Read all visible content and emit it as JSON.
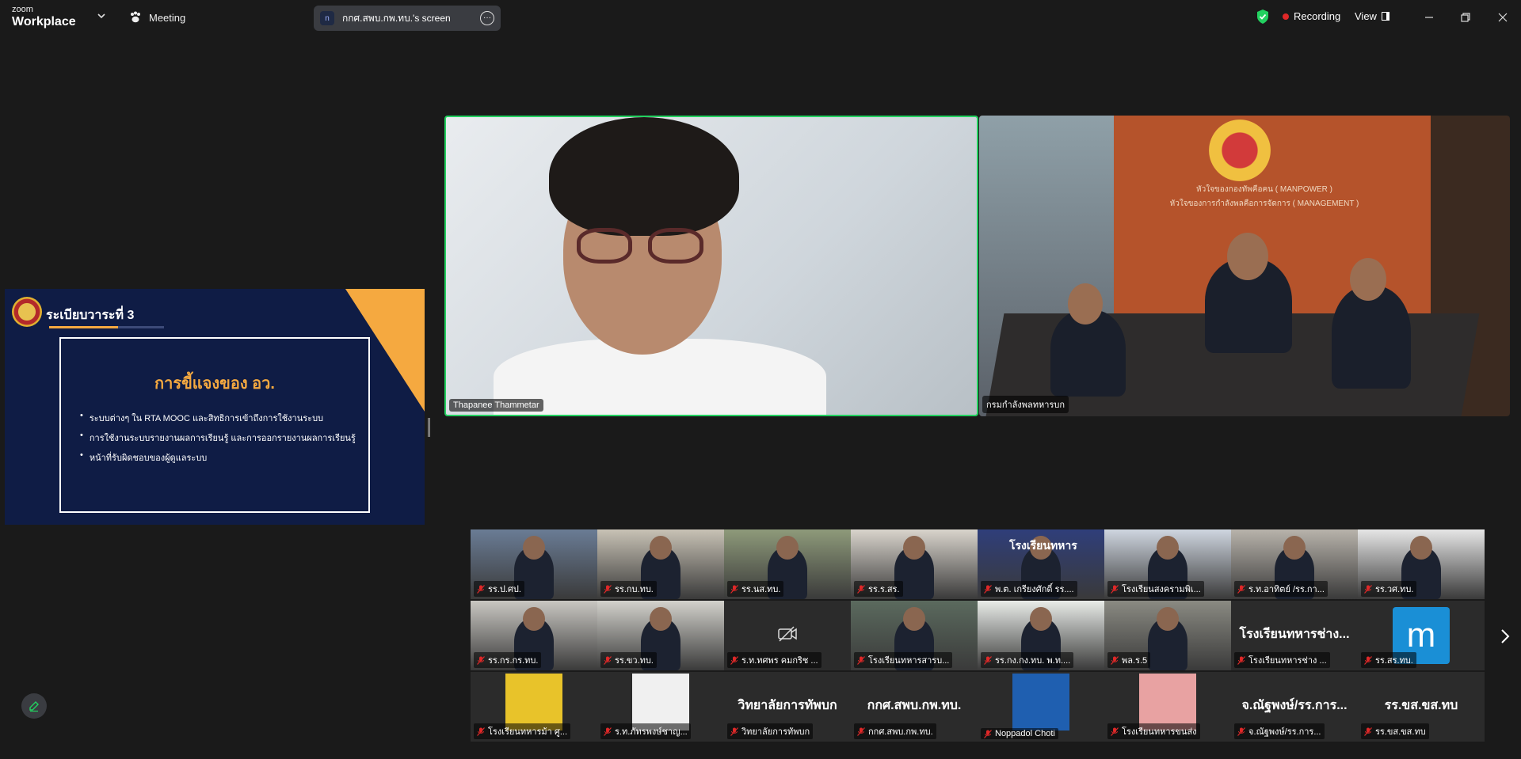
{
  "app": {
    "brand_small": "zoom",
    "brand_big": "Workplace",
    "meeting_label": "Meeting",
    "screen_share_avatar": "n",
    "screen_share_label": "กกศ.สพบ.กพ.ทบ.'s screen",
    "recording_label": "Recording",
    "view_label": "View",
    "icons": [
      "chevron-down-icon",
      "paw-icon",
      "more-icon",
      "shield-check-icon",
      "record-dot-icon",
      "view-grid-icon",
      "minimize-icon",
      "restore-icon",
      "close-icon",
      "next-page-icon",
      "edit-icon",
      "mic-muted-icon",
      "video-off-icon"
    ],
    "colors": {
      "active_speaker": "#23d160",
      "recording": "#e02828",
      "shield": "#23d160",
      "slide_bg": "#0f1c45",
      "slide_accent": "#f5a940"
    }
  },
  "slide": {
    "title": "ระเบียบวาระที่ 3",
    "heading": "การขี้แจงของ อว.",
    "bullets": [
      "ระบบต่างๆ ใน RTA MOOC และสิทธิการเข้าถึงการใช้งานระบบ",
      "การใช้งานระบบรายงานผลการเรียนรู้ และการออกรายงานผลการเรียนรู้",
      "หน้าที่รับผิดชอบของผู้ดูแลระบบ"
    ]
  },
  "main_tiles": [
    {
      "name": "Thapanee Thammetar"
    },
    {
      "name": "กรมกำลังพลทหารบก",
      "wall_line1": "หัวใจของกองทัพคือคน ( MANPOWER )",
      "wall_line2": "หัวใจของการกำลังพลคือการจัดการ ( MANAGEMENT )"
    }
  ],
  "gallery": [
    {
      "name": "รร.ป.ศป.",
      "kind": "video",
      "bg": "#6a7c95"
    },
    {
      "name": "รร.กบ.ทบ.",
      "kind": "video",
      "bg": "#c8c2b5"
    },
    {
      "name": "รร.นส.ทบ.",
      "kind": "video",
      "bg": "#8e9a7a"
    },
    {
      "name": "รร.ร.สร.",
      "kind": "video",
      "bg": "#d9d4cc"
    },
    {
      "name": "พ.ต. เกรียงศักดิ์ รร....",
      "kind": "video",
      "bg": "#2f3e7a",
      "overlay": "โรงเรียนทหาร"
    },
    {
      "name": "โรงเรียนสงครามพิเ...",
      "kind": "video",
      "bg": "#cfd6e0"
    },
    {
      "name": "ร.ท.อาทิตย์ /รร.กา...",
      "kind": "video",
      "bg": "#b8b3ab"
    },
    {
      "name": "รร.วศ.ทบ.",
      "kind": "video",
      "bg": "#e6e6e6"
    },
    {
      "name": "รร.กร.กร.ทบ.",
      "kind": "video",
      "bg": "#c9c7c2"
    },
    {
      "name": "รร.ขว.ทบ.",
      "kind": "video",
      "bg": "#d3d2cc"
    },
    {
      "name": "ร.ท.ทศพร คมกริช ...",
      "kind": "video-off",
      "bg": "#333333"
    },
    {
      "name": "โรงเรียนทหารสารบ...",
      "kind": "video",
      "bg": "#5b6a5e"
    },
    {
      "name": "รร.กง.กง.ทบ. พ.ท....",
      "kind": "video",
      "bg": "#e9ece8"
    },
    {
      "name": "พล.ร.5",
      "kind": "video",
      "bg": "#8a8a82"
    },
    {
      "name": "โรงเรียนทหารช่าง ...",
      "kind": "text",
      "display": "โรงเรียนทหารช่าง..."
    },
    {
      "name": "รร.สร.ทบ.",
      "kind": "letter",
      "display": "m"
    },
    {
      "name": "โรงเรียนทหารม้า ศู...",
      "kind": "image",
      "bg": "#e8c32a"
    },
    {
      "name": "ร.ท.ภัทรพงษ์ชาญ...",
      "kind": "image",
      "bg": "#f0f0f0"
    },
    {
      "name": "วิทยาลัยการทัพบก",
      "kind": "text",
      "display": "วิทยาลัยการทัพบก"
    },
    {
      "name": "กกศ.สพบ.กพ.ทบ.",
      "kind": "text",
      "display": "กกศ.สพบ.กพ.ทบ."
    },
    {
      "name": "Noppadol Choti",
      "kind": "image",
      "bg": "#1f5fb0"
    },
    {
      "name": "โรงเรียนทหารขนส่ง",
      "kind": "image",
      "bg": "#e8a2a2"
    },
    {
      "name": "จ.ณัฐพงษ์/รร.การ...",
      "kind": "text",
      "display": "จ.ณัฐพงษ์/รร.การ..."
    },
    {
      "name": "รร.ขส.ขส.ทบ",
      "kind": "text",
      "display": "รร.ขส.ขส.ทบ"
    }
  ]
}
